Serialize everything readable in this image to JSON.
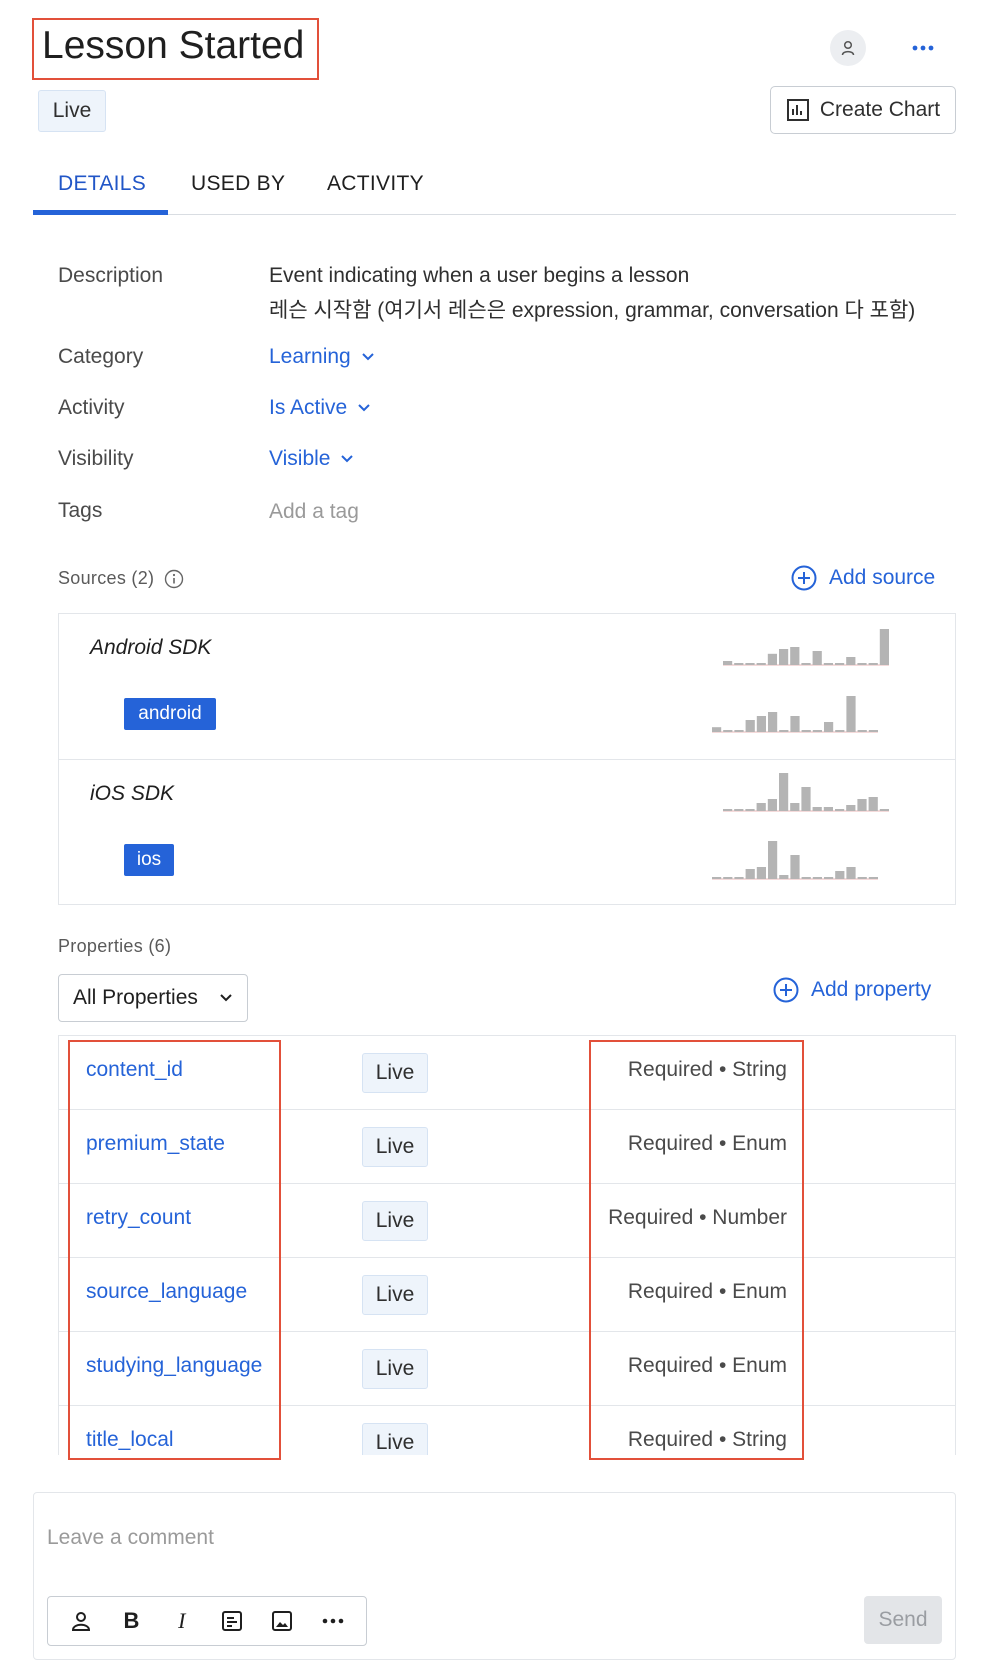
{
  "header": {
    "title": "Lesson Started",
    "status": "Live",
    "create_chart_label": "Create Chart",
    "icons": {
      "user": "user-icon",
      "more": "more-icon",
      "chart": "chart-icon"
    }
  },
  "tabs": [
    {
      "label": "DETAILS",
      "active": true
    },
    {
      "label": "USED BY",
      "active": false
    },
    {
      "label": "ACTIVITY",
      "active": false
    }
  ],
  "details": {
    "description_label": "Description",
    "description_line1": "Event indicating when a user begins a lesson",
    "description_line2": "레슨 시작함 (여기서 레슨은 expression, grammar, conversation 다 포함)",
    "category_label": "Category",
    "category_value": "Learning",
    "activity_label": "Activity",
    "activity_value": "Is Active",
    "visibility_label": "Visibility",
    "visibility_value": "Visible",
    "tags_label": "Tags",
    "tags_placeholder": "Add a tag"
  },
  "sources": {
    "label": "Sources (2)",
    "add_label": "Add source",
    "items": [
      {
        "name": "Android SDK",
        "platform": "android"
      },
      {
        "name": "iOS SDK",
        "platform": "ios"
      }
    ]
  },
  "properties": {
    "label": "Properties (6)",
    "filter_value": "All Properties",
    "add_label": "Add property",
    "rows": [
      {
        "name": "content_id",
        "status": "Live",
        "type": "Required • String"
      },
      {
        "name": "premium_state",
        "status": "Live",
        "type": "Required • Enum"
      },
      {
        "name": "retry_count",
        "status": "Live",
        "type": "Required • Number"
      },
      {
        "name": "source_language",
        "status": "Live",
        "type": "Required • Enum"
      },
      {
        "name": "studying_language",
        "status": "Live",
        "type": "Required • Enum"
      },
      {
        "name": "title_local",
        "status": "Live",
        "type": "Required • String"
      }
    ]
  },
  "comment": {
    "placeholder": "Leave a comment",
    "send_label": "Send",
    "bold_label": "B",
    "italic_label": "I"
  },
  "colors": {
    "accent": "#2563d8",
    "annotation": "#e2503a",
    "spark_bar": "#b4b4b4",
    "spark_baseline": "#e8b4b4"
  }
}
